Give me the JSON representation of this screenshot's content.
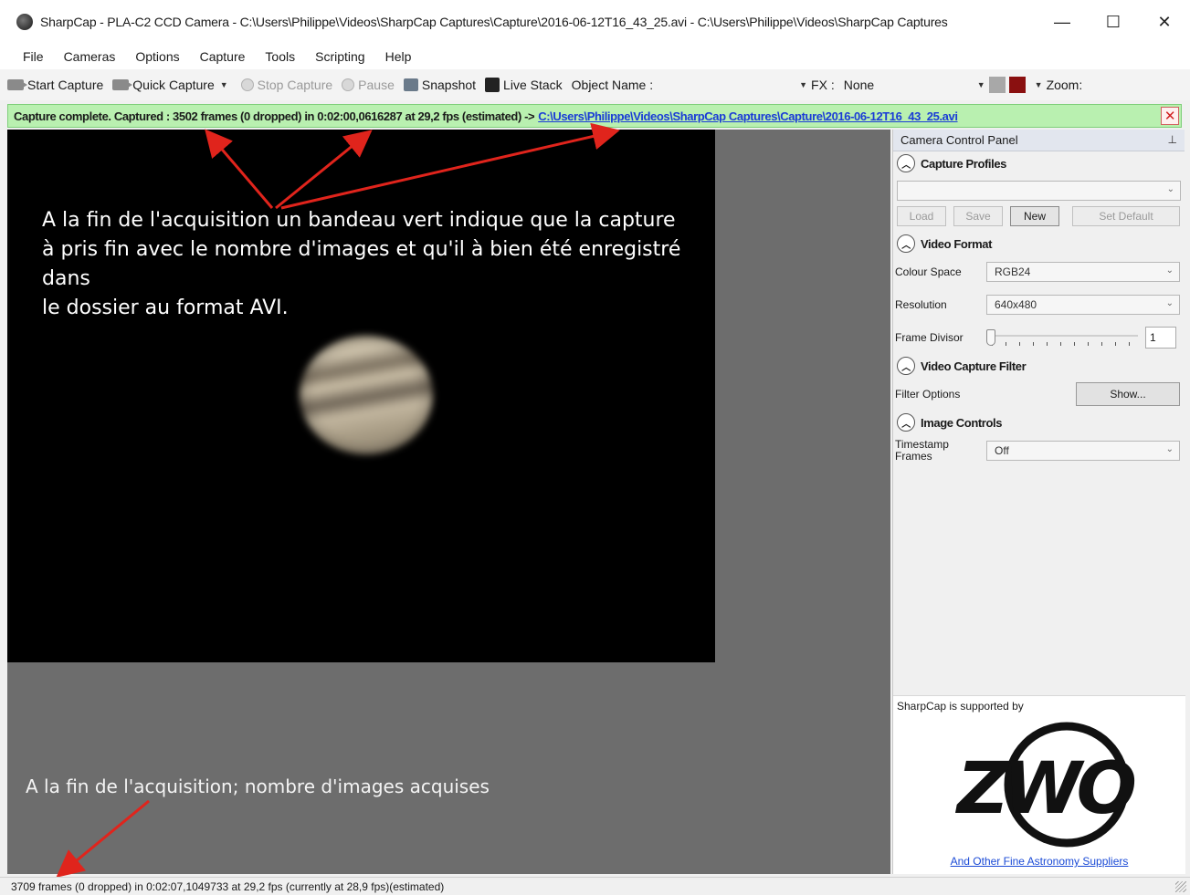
{
  "window": {
    "title": "SharpCap - PLA-C2 CCD Camera - C:\\Users\\Philippe\\Videos\\SharpCap Captures\\Capture\\2016-06-12T16_43_25.avi - C:\\Users\\Philippe\\Videos\\SharpCap Captures",
    "minimize": "—",
    "maximize": "☐",
    "close": "✕"
  },
  "menu": [
    "File",
    "Cameras",
    "Options",
    "Capture",
    "Tools",
    "Scripting",
    "Help"
  ],
  "toolbar": {
    "start_capture": "Start Capture",
    "quick_capture": "Quick Capture",
    "stop_capture": "Stop Capture",
    "pause": "Pause",
    "snapshot": "Snapshot",
    "live_stack": "Live Stack",
    "object_name_label": "Object Name :",
    "object_name_value": "",
    "fx_label": "FX :",
    "fx_value": "None",
    "zoom_label": "Zoom:"
  },
  "banner": {
    "text": "Capture complete. Captured : 3502 frames (0 dropped) in 0:02:00,0616287 at 29,2 fps (estimated) ->",
    "link": "C:\\Users\\Philippe\\Videos\\SharpCap Captures\\Capture\\2016-06-12T16_43_25.avi",
    "close": "✕"
  },
  "annotations": {
    "top_line1": "A la fin de l'acquisition un bandeau vert indique que la capture",
    "top_line2": "à pris fin avec le nombre d'images et qu'il à bien été enregistré dans",
    "top_line3": "le dossier au format AVI.",
    "bottom": "A la fin de l'acquisition; nombre d'images acquises"
  },
  "panel": {
    "title": "Camera Control Panel",
    "pin": "⊥",
    "capture_profiles": {
      "heading": "Capture Profiles",
      "profile_value": "",
      "buttons": {
        "load": "Load",
        "save": "Save",
        "new": "New",
        "set_default": "Set Default"
      }
    },
    "video_format": {
      "heading": "Video Format",
      "colour_space_label": "Colour Space",
      "colour_space_value": "RGB24",
      "resolution_label": "Resolution",
      "resolution_value": "640x480",
      "frame_divisor_label": "Frame Divisor",
      "frame_divisor_value": "1",
      "frame_divisor_level": 0
    },
    "video_capture_filter": {
      "heading": "Video Capture Filter",
      "filter_options_label": "Filter Options",
      "show_button": "Show..."
    },
    "image_controls": {
      "heading": "Image Controls",
      "timestamp_label": "Timestamp Frames",
      "timestamp_value": "Off"
    },
    "sponsor": {
      "label": "SharpCap is supported by",
      "logo_text": "ZWO",
      "link": "And Other Fine Astronomy Suppliers"
    }
  },
  "statusbar": {
    "text": "3709 frames (0 dropped) in 0:02:07,1049733 at 29,2 fps  (currently at 28,9 fps)(estimated)"
  },
  "colors": {
    "banner_bg": "#b9f0b0",
    "arrow": "#e0241c",
    "link": "#1a3cd6",
    "preview_bg": "#000000",
    "workspace_bg": "#6d6d6d"
  }
}
